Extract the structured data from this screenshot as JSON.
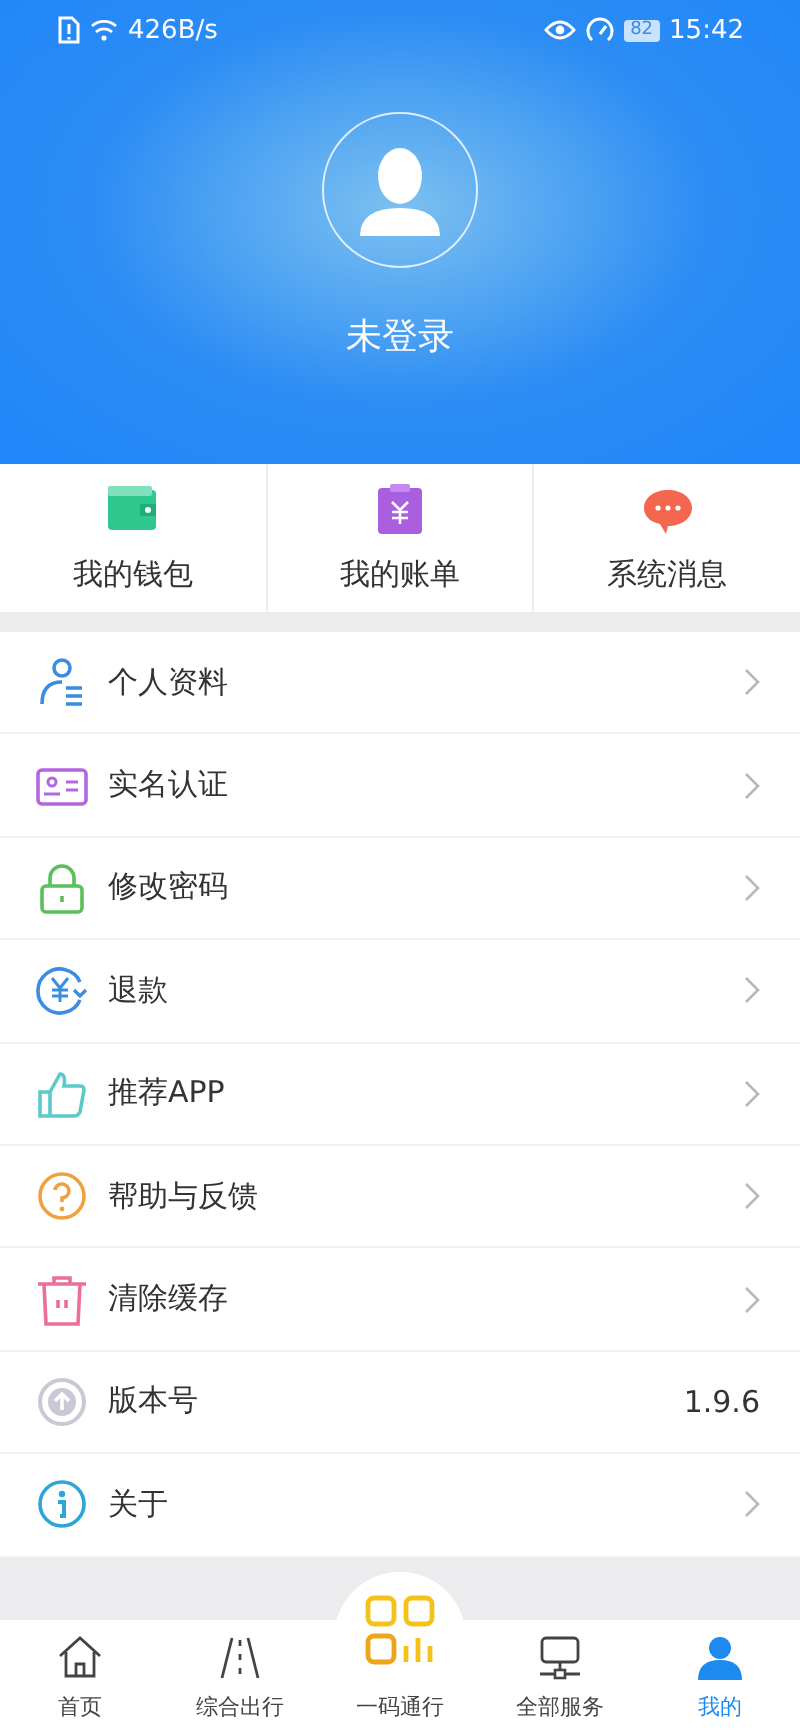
{
  "status_bar": {
    "speed": "426B/s",
    "battery": "82",
    "time": "15:42"
  },
  "profile": {
    "name": "未登录"
  },
  "shortcuts": [
    {
      "label": "我的钱包",
      "kind": "wallet"
    },
    {
      "label": "我的账单",
      "kind": "bill"
    },
    {
      "label": "系统消息",
      "kind": "message"
    }
  ],
  "menu": [
    {
      "label": "个人资料",
      "kind": "profile"
    },
    {
      "label": "实名认证",
      "kind": "idcard"
    },
    {
      "label": "修改密码",
      "kind": "lock"
    },
    {
      "label": "退款",
      "kind": "refund"
    },
    {
      "label": "推荐APP",
      "kind": "thumb"
    },
    {
      "label": "帮助与反馈",
      "kind": "help"
    },
    {
      "label": "清除缓存",
      "kind": "trash"
    },
    {
      "label": "版本号",
      "kind": "version",
      "value": "1.9.6"
    },
    {
      "label": "关于",
      "kind": "info"
    }
  ],
  "tabs": [
    {
      "label": "首页",
      "kind": "home",
      "selected": false
    },
    {
      "label": "综合出行",
      "kind": "road",
      "selected": false
    },
    {
      "label": "一码通行",
      "kind": "code",
      "selected": false
    },
    {
      "label": "全部服务",
      "kind": "services",
      "selected": false
    },
    {
      "label": "我的",
      "kind": "me",
      "selected": true
    }
  ]
}
